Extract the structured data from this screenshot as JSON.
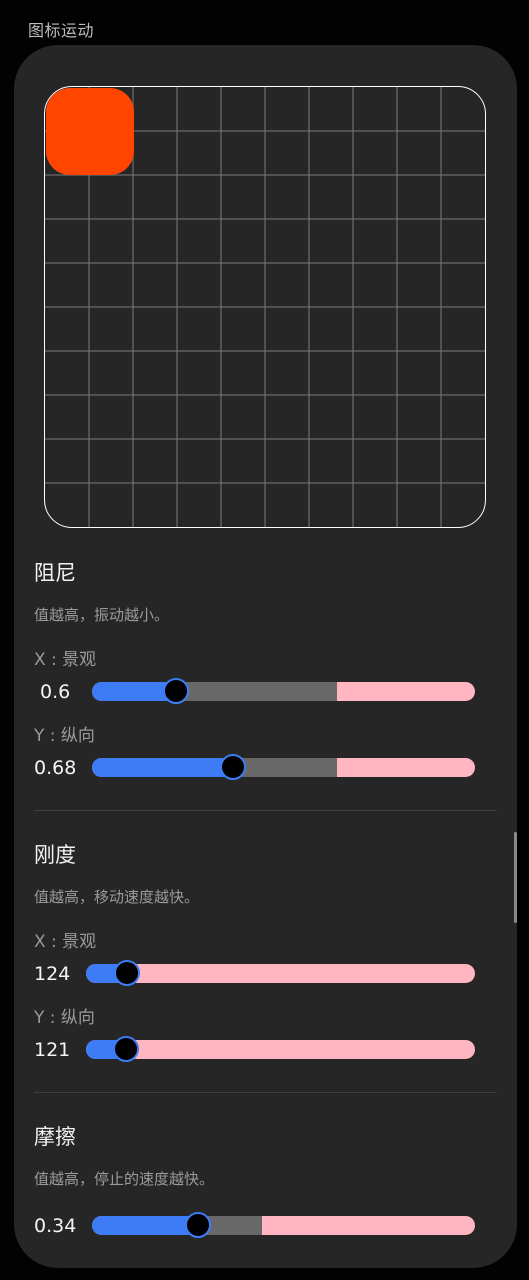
{
  "header": {
    "title": "图标运动"
  },
  "colors": {
    "icon": "#ff4500",
    "fill": "#3d7cf5",
    "remaining": "#ffb6c1",
    "range": "#686868",
    "card_bg": "#262626"
  },
  "damping": {
    "title": "阻尼",
    "desc": "值越高，振动越小。",
    "x": {
      "label": "X : 景观",
      "value": "0.6",
      "fraction": 0.22,
      "range_fraction": 0.64
    },
    "y": {
      "label": "Y : 纵向",
      "value": "0.68",
      "fraction": 0.368,
      "range_fraction": 0.64
    }
  },
  "stiffness": {
    "title": "刚度",
    "desc": "值越高，移动速度越快。",
    "x": {
      "label": "X : 景观",
      "value": "124",
      "fraction": 0.105
    },
    "y": {
      "label": "Y : 纵向",
      "value": "121",
      "fraction": 0.103
    }
  },
  "friction": {
    "title": "摩擦",
    "desc": "值越高，停止的速度越快。",
    "value": "0.34",
    "fraction": 0.278,
    "range_fraction": 0.445
  }
}
